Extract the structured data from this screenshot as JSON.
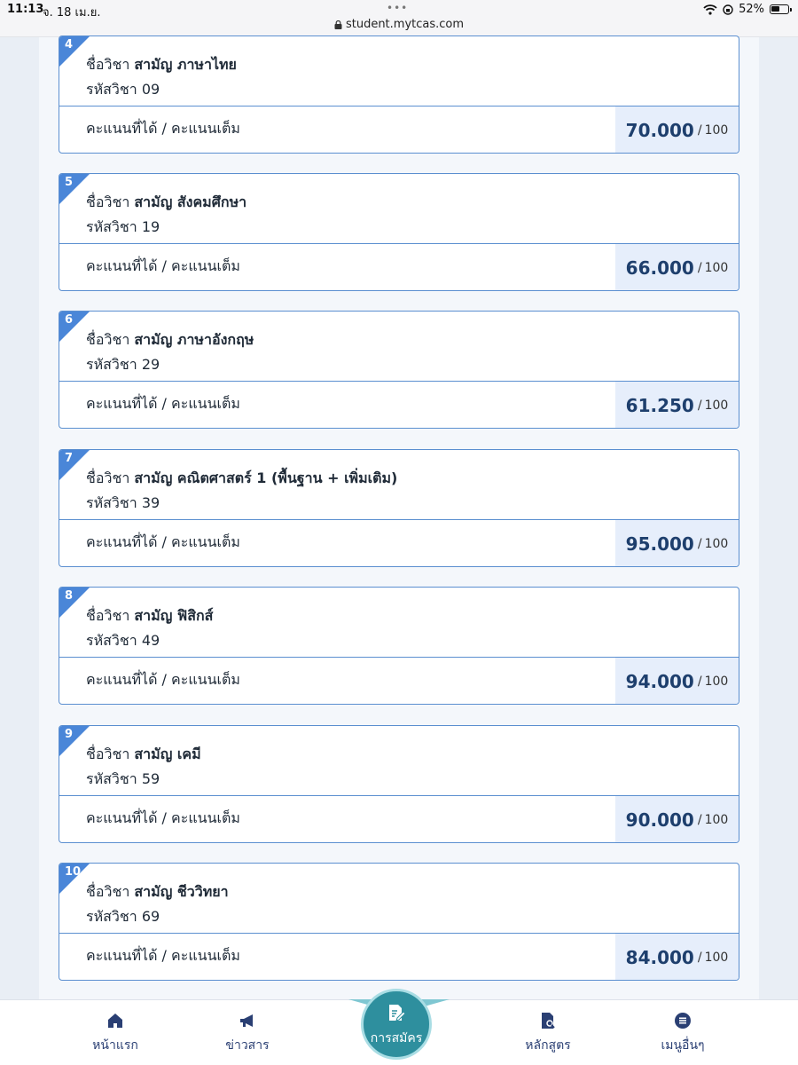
{
  "status_bar": {
    "time": "11:13",
    "date": "จ. 18 เม.ย.",
    "url": "student.mytcas.com",
    "battery": "52%"
  },
  "labels": {
    "subject_name": "ชื่อวิชา",
    "subject_code": "รหัสวิชา",
    "score": "คะแนนที่ได้ / คะแนนเต็ม",
    "separator": "/"
  },
  "subjects": [
    {
      "number": "4",
      "name": "สามัญ ภาษาไทย",
      "code": "09",
      "score": "70.000",
      "max": "100"
    },
    {
      "number": "5",
      "name": "สามัญ สังคมศึกษา",
      "code": "19",
      "score": "66.000",
      "max": "100"
    },
    {
      "number": "6",
      "name": "สามัญ ภาษาอังกฤษ",
      "code": "29",
      "score": "61.250",
      "max": "100"
    },
    {
      "number": "7",
      "name": "สามัญ คณิตศาสตร์ 1 (พื้นฐาน + เพิ่มเติม)",
      "code": "39",
      "score": "95.000",
      "max": "100"
    },
    {
      "number": "8",
      "name": "สามัญ ฟิสิกส์",
      "code": "49",
      "score": "94.000",
      "max": "100"
    },
    {
      "number": "9",
      "name": "สามัญ เคมี",
      "code": "59",
      "score": "90.000",
      "max": "100"
    },
    {
      "number": "10",
      "name": "สามัญ ชีววิทยา",
      "code": "69",
      "score": "84.000",
      "max": "100"
    }
  ],
  "nav": {
    "home": "หน้าแรก",
    "news": "ข่าวสาร",
    "apply": "การสมัคร",
    "courses": "หลักสูตร",
    "more": "เมนูอื่นๆ"
  },
  "colors": {
    "accent": "#4a86d8",
    "card_border": "#5b8fd0",
    "score_bg": "#e6eefb",
    "nav_center": "#2e8f9e"
  }
}
